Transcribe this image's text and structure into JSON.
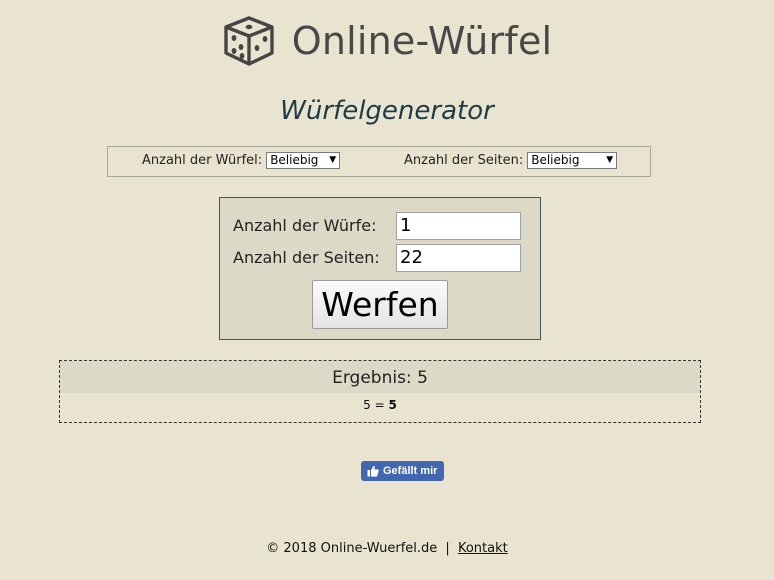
{
  "header": {
    "title": "Online-Würfel",
    "logo_icon": "dice-icon"
  },
  "subtitle": "Würfelgenerator",
  "settings": {
    "dice_count_label": "Anzahl der Würfel:",
    "dice_count_value": "Beliebig",
    "sides_label": "Anzahl der Seiten:",
    "sides_value": "Beliebig"
  },
  "form": {
    "rolls_label": "Anzahl der Würfe:",
    "rolls_value": "1",
    "sides_label": "Anzahl der Seiten:",
    "sides_value": "22",
    "roll_button": "Werfen"
  },
  "result": {
    "label": "Ergebnis: 5",
    "detail_prefix": "5 = ",
    "detail_sum": "5"
  },
  "like_button": {
    "label": "Gefällt mir",
    "icon": "thumbs-up-icon",
    "color": "#4267b2"
  },
  "footer": {
    "copyright": "© 2018 Online-Wuerfel.de",
    "separator": "|",
    "contact_link": "Kontakt"
  },
  "colors": {
    "background": "#e8e4cf",
    "panel": "#dcdac6",
    "subtitle": "#1f3a48"
  }
}
